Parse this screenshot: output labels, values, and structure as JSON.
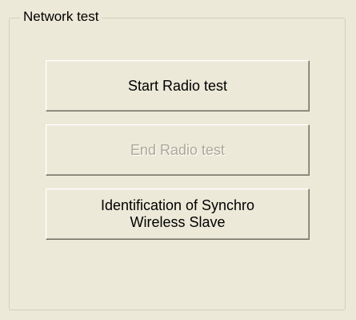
{
  "groupbox": {
    "title": "Network test"
  },
  "buttons": {
    "start_radio_test": "Start Radio test",
    "end_radio_test": "End Radio test",
    "identification": "Identification of Synchro\nWireless Slave"
  },
  "states": {
    "end_radio_test_enabled": false
  }
}
